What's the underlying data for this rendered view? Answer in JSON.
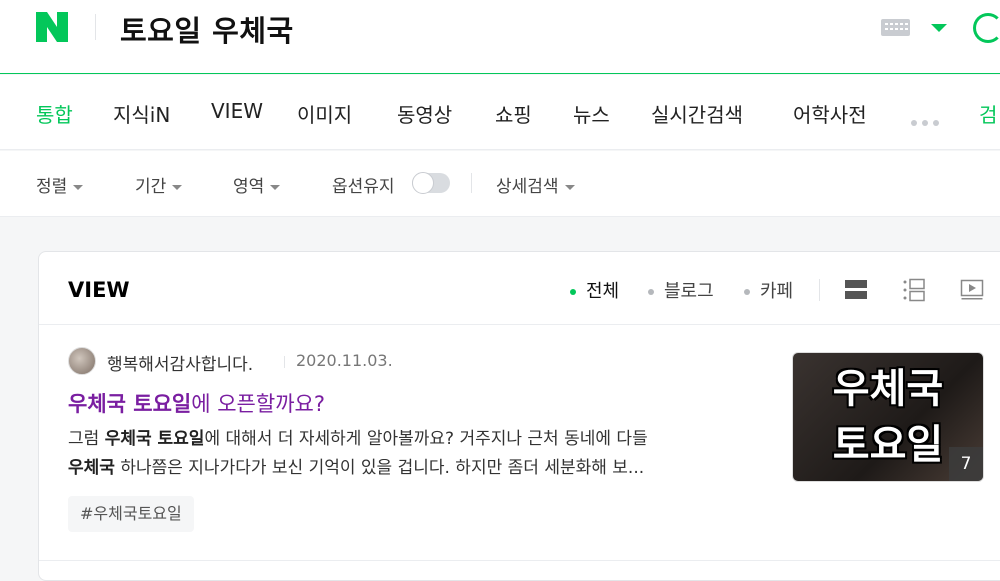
{
  "header": {
    "logo": "N",
    "query": "토요일 우체국",
    "accent_color": "#03c75a",
    "icons": [
      "keyboard-icon",
      "chevron-down-icon",
      "search-icon"
    ]
  },
  "tabs": [
    {
      "label": "통합",
      "active": true
    },
    {
      "label": "지식iN"
    },
    {
      "label": "VIEW"
    },
    {
      "label": "이미지"
    },
    {
      "label": "동영상"
    },
    {
      "label": "쇼핑"
    },
    {
      "label": "뉴스"
    },
    {
      "label": "실시간검색"
    },
    {
      "label": "어학사전"
    },
    {
      "label": "검"
    }
  ],
  "options": {
    "sort": "정렬",
    "period": "기간",
    "area": "영역",
    "keep_option": "옵션유지",
    "detail_search": "상세검색"
  },
  "view_section": {
    "title": "VIEW",
    "filters": [
      {
        "label": "전체",
        "active": true
      },
      {
        "label": "블로그"
      },
      {
        "label": "카페"
      }
    ],
    "result": {
      "author": "행복해서감사합니다.",
      "date": "2020.11.03.",
      "title_highlight": "우체국 토요일",
      "title_rest": "에 오픈할까요?",
      "snippet_l1_a": "그럼 ",
      "snippet_l1_b": "우체국 토요일",
      "snippet_l1_c": "에 대해서 더 자세하게 알아볼까요? 거주지나 근처 동네에 다들",
      "snippet_l2_a": "우체국",
      "snippet_l2_b": " 하나쯤은 지나가다가 보신 기억이 있을 겁니다. 하지만 좀더 세분화해 보...",
      "tag": "#우체국토요일",
      "thumb_line1": "우체국",
      "thumb_line2": "토요일",
      "thumb_count": "7"
    }
  }
}
